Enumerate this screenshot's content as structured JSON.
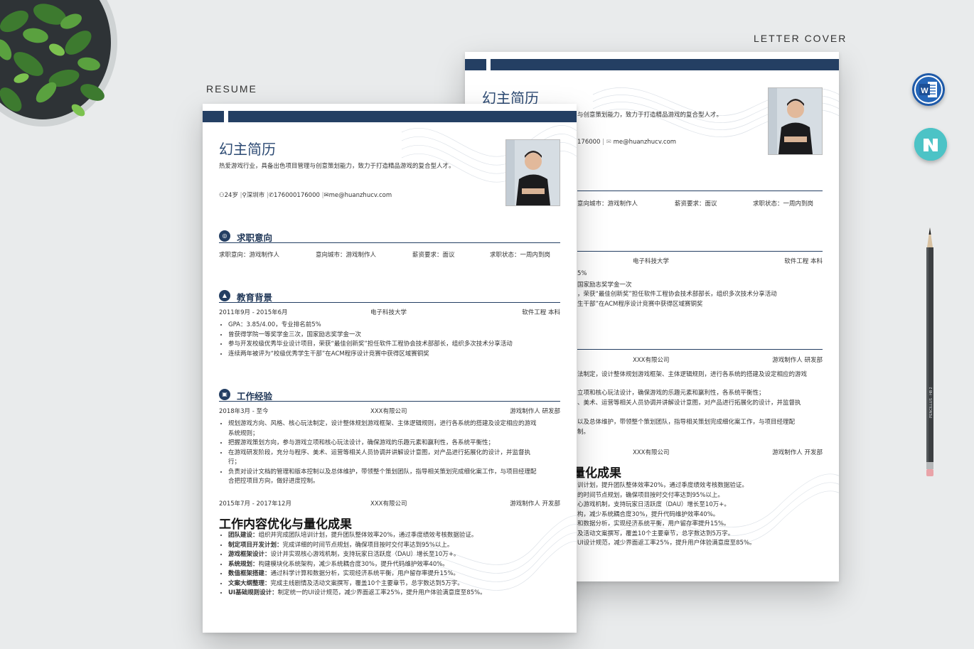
{
  "labels": {
    "resume": "RESUME",
    "cover": "LETTER COVER"
  },
  "colors": {
    "navy": "#243f63",
    "background": "#e9ebec",
    "word_blue": "#1f5aa8",
    "teal_icon": "#4cc3c6"
  },
  "icons": {
    "word": "word-app-icon",
    "teal": "teal-app-icon",
    "pencil": "pencil"
  },
  "pencil_text": "PENCILLUS · HB 2",
  "resume": {
    "name": "幻主简历",
    "slogan": "热爱游戏行业，具备出色项目管理与创意策划能力，致力于打造精品游戏的复合型人才。",
    "age": "24岁",
    "city": "深圳市",
    "phone": "176000176000",
    "email": "me@huanzhucv.com",
    "intent": {
      "title": "求职意向",
      "position": "求职意向：游戏制作人",
      "city": "意向城市：游戏制作人",
      "salary": "薪资要求：面议",
      "status": "求职状态：一周内到岗"
    },
    "education": {
      "title": "教育背景",
      "date": "2011年9月 - 2015年6月",
      "school": "电子科技大学",
      "major": "软件工程 本科",
      "items": [
        "GPA：3.85/4.00，专业排名前5%",
        "曾获得学院一等奖学金三次，国家励志奖学金一次",
        "参与开发校级优秀毕业设计项目，荣获“最佳创新奖”担任软件工程协会技术部部长，组织多次技术分享活动",
        "连续两年被评为“校级优秀学生干部”在ACM程序设计竞赛中获得区域赛铜奖"
      ]
    },
    "work": {
      "title": "工作经验",
      "job1": {
        "date": "2018年3月 - 至今",
        "company": "XXX有限公司",
        "role": "游戏制作人 研发部",
        "items": [
          "规划游戏方向、风格、核心玩法制定，设计整体规划游戏框架、主体逻辑规则，进行各系统的搭建及设定相应的游戏",
          "系统规则；",
          "把握游戏策划方向，参与游戏立项和核心玩法设计，确保游戏的乐趣元素和赢利性，各系统平衡性；",
          "在游戏研发阶段，充分与程序、美术、运营等相关人员协调并讲解设计意图，对产品进行拓展化的设计，并监督执",
          "行；",
          "负责对设计文档的管理和版本控制以及总体维护，带领整个策划团队，指导相关策划完成细化案工作，与项目经理配",
          "合把控项目方向，做好进度控制。"
        ]
      },
      "job2": {
        "date": "2015年7月 - 2017年12月",
        "company": "XXX有限公司",
        "role": "游戏制作人 开发部"
      }
    },
    "optimize": {
      "title": "工作内容优化与量化成果",
      "items": [
        {
          "k": "团队建设：",
          "v": "组织并完成团队培训计划，提升团队整体效率20%，通过季度绩效考核数据验证。"
        },
        {
          "k": "制定项目开发计划：",
          "v": "完成详细的时间节点规划，确保项目按时交付率达到95%以上。"
        },
        {
          "k": "游戏框架设计：",
          "v": "设计并实现核心游戏机制，支持玩家日活跃度（DAU）增长至10万+。"
        },
        {
          "k": "系统规划：",
          "v": "构建模块化系统架构，减少系统耦合度30%，提升代码维护效率40%。"
        },
        {
          "k": "数值框架搭建：",
          "v": "通过科学计算和数据分析，实现经济系统平衡，用户留存率提升15%。"
        },
        {
          "k": "文案大纲整理：",
          "v": "完成主线剧情及活动文案撰写，覆盖10个主要章节，总字数达到5万字。"
        },
        {
          "k": "UI基础规则设计：",
          "v": "制定统一的UI设计规范，减少界面返工率25%，提升用户体验满意度至85%。"
        }
      ]
    }
  },
  "cover": {
    "name": "幻主简历",
    "slogan_frag": "与创意策划能力，致力于打造精品游戏的复合型人才。",
    "contact_frag_phone": "176000",
    "contact_frag_email": "me@huanzhucv.com",
    "intent_city": "意向城市：游戏制作人",
    "intent_salary": "薪资要求：面议",
    "intent_status": "求职状态：一周内到岗",
    "school": "电子科技大学",
    "major": "软件工程 本科",
    "edu_frags": [
      "5%",
      "国家励志奖学金一次",
      "，荣获“最佳创新奖”担任软件工程协会技术部部长，组织多次技术分享活动",
      "生干部”在ACM程序设计竞赛中获得区域赛铜奖"
    ],
    "company1": "XXX有限公司",
    "role1": "游戏制作人 研发部",
    "work_frags": [
      "法制定，设计整体规划游戏框架、主体逻辑规则，进行各系统的搭建及设定相应的游戏",
      "",
      "立项和核心玩法设计，确保游戏的乐趣元素和赢利性，各系统平衡性；",
      "、美术、运营等相关人员协调并讲解设计意图，对产品进行拓展化的设计，并监督执",
      "",
      "以及总体维护，带领整个策划团队，指导相关策划完成细化案工作，与项目经理配",
      "制。"
    ],
    "company2": "XXX有限公司",
    "role2": "游戏制作人 开发部",
    "opt_heading_frag": "量化成果",
    "opt_frags": [
      "训计划，提升团队整体效率20%，通过季度绩效考核数据验证。",
      "的时间节点规划，确保项目按时交付率达到95%以上。",
      "心游戏机制，支持玩家日活跃度（DAU）增长至10万+。",
      "构，减少系统耦合度30%，提升代码维护效率40%。",
      "和数据分析，实现经济系统平衡，用户留存率提升15%。",
      "及活动文案撰写，覆盖10个主要章节，总字数达到5万字。",
      "UI设计规范，减少界面返工率25%，提升用户体验满意度至85%。"
    ]
  }
}
